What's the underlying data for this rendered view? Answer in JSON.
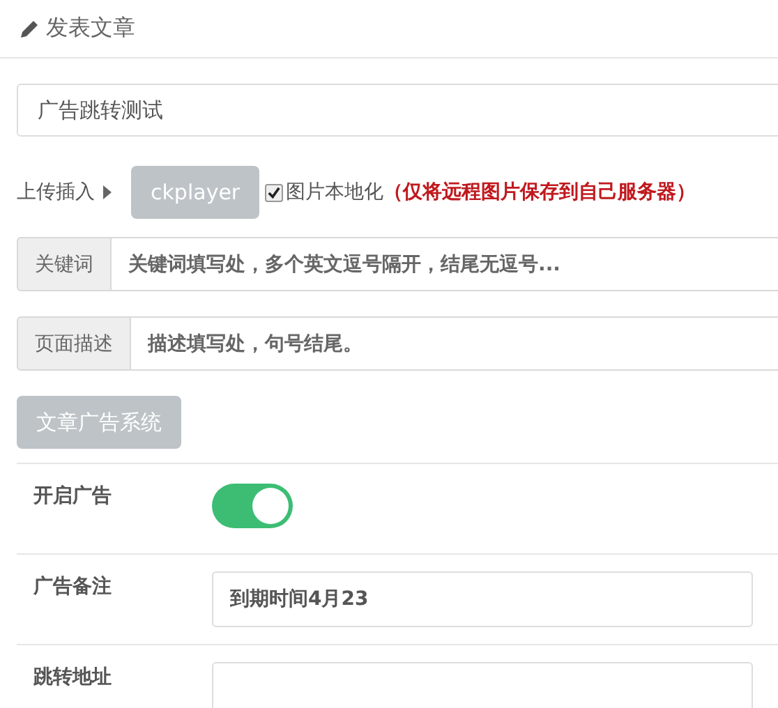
{
  "header": {
    "title": "发表文章"
  },
  "title_field": {
    "value": "广告跳转测试"
  },
  "upload": {
    "label": "上传插入",
    "button": "ckplayer",
    "localize": {
      "label": "图片本地化",
      "checked": true,
      "note": "（仅将远程图片保存到自己服务器）"
    }
  },
  "keywords": {
    "addon": "关键词",
    "value": "关键词填写处，多个英文逗号隔开，结尾无逗号..."
  },
  "description": {
    "addon": "页面描述",
    "value": "描述填写处，句号结尾。"
  },
  "section_button": "文章广告系统",
  "ad_settings": [
    {
      "kind": "toggle",
      "label": "开启广告",
      "on": true
    },
    {
      "kind": "text",
      "label": "广告备注",
      "value": "到期时间4月23"
    },
    {
      "kind": "text",
      "label": "跳转地址"
    }
  ]
}
